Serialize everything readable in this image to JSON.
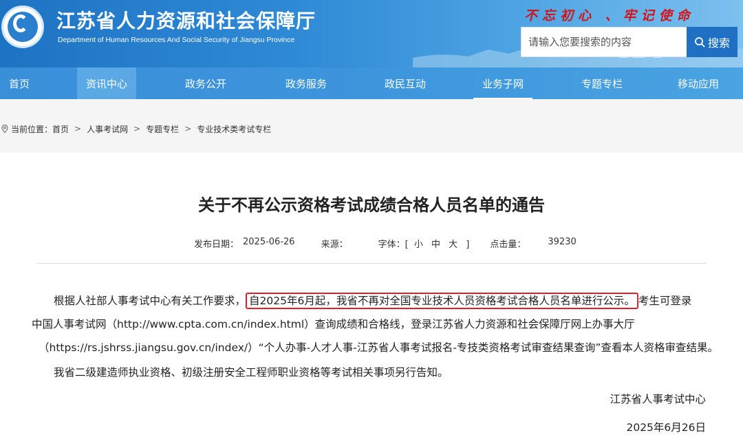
{
  "header": {
    "title": "江苏省人力资源和社会保障厅",
    "subtitle": "Department of Human Resources And Social Security of Jiangsu Province",
    "slogan": "不忘初心 、牢记使命",
    "search_placeholder": "请输入您要搜索的内容",
    "search_button": "搜索"
  },
  "nav": {
    "items": [
      {
        "label": "首页"
      },
      {
        "label": "资讯中心"
      },
      {
        "label": "政务公开"
      },
      {
        "label": "政务服务"
      },
      {
        "label": "政民互动"
      },
      {
        "label": "业务子网"
      },
      {
        "label": "专题专栏"
      },
      {
        "label": "移动应用"
      }
    ]
  },
  "breadcrumb": {
    "prefix": "当前位置：",
    "items": [
      "首页",
      "人事考试网",
      "专题专栏",
      "专业技术类考试专栏"
    ],
    "separator": ">"
  },
  "article": {
    "title": "关于不再公示资格考试成绩合格人员名单的通告",
    "meta": {
      "date_label": "发布日期：",
      "date": "2025-06-26",
      "source_label": "来源：",
      "source": "",
      "font_label": "字体：[",
      "font_small": "小",
      "font_medium": "中",
      "font_large": "大",
      "font_close": "]",
      "views_label": "点击量：",
      "views": "39230"
    },
    "p1_before": "根据人社部人事考试中心有关工作要求，",
    "p1_highlight": "自2025年6月起，我省不再对全国专业技术人员资格考试合格人员名单进行公示。",
    "p1_after": "考生可登录",
    "p1_line2": "中国人事考试网（http://www.cpta.com.cn/index.html）查询成绩和合格线，登录江苏省人力资源和社会保障厅网上办事大厅",
    "p1_line3": "（https://rs.jshrss.jiangsu.gov.cn/index/）“个人办事-人才人事-江苏省人事考试报名-专技类资格考试审查结果查询”查看本人资格审查结果。",
    "p2": "我省二级建造师执业资格、初级注册安全工程师职业资格等考试相关事项另行告知。",
    "signature": "江苏省人事考试中心",
    "sign_date": "2025年6月26日"
  },
  "colors": {
    "header_blue": "#1e73c3",
    "nav_blue": "#3d95dc",
    "slogan_red": "#d0161c",
    "highlight_red": "#e0202a"
  }
}
